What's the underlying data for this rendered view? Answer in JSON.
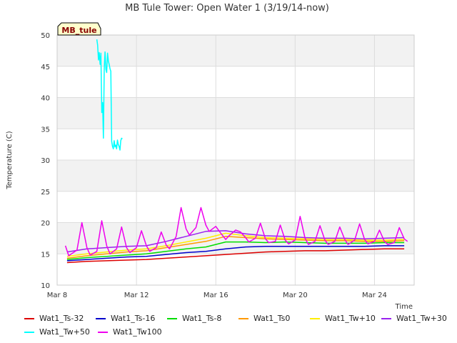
{
  "chart_data": {
    "type": "line",
    "title": "MB Tule Tower: Open Water 1 (3/19/14-now)",
    "xlabel": "Time",
    "ylabel": "Temperature (C)",
    "xlim": [
      "2014-03-08",
      "2014-03-26"
    ],
    "ylim": [
      10,
      50
    ],
    "x_ticks": [
      {
        "date": "2014-03-08",
        "label": "Mar 8"
      },
      {
        "date": "2014-03-12",
        "label": "Mar 12"
      },
      {
        "date": "2014-03-16",
        "label": "Mar 16"
      },
      {
        "date": "2014-03-20",
        "label": "Mar 20"
      },
      {
        "date": "2014-03-24",
        "label": "Mar 24"
      }
    ],
    "y_ticks": [
      10,
      15,
      20,
      25,
      30,
      35,
      40,
      45,
      50
    ],
    "grid": true,
    "banding": "alternating gray bands between y ticks",
    "annotation": "MB_tule",
    "legend_position": "bottom",
    "series": [
      {
        "name": "Wat1_Ts-32",
        "color": "#dd0000",
        "x": [
          "2014-03-08T12:00",
          "2014-03-09T12:00",
          "2014-03-10T12:00",
          "2014-03-11T12:00",
          "2014-03-12T12:00",
          "2014-03-13T12:00",
          "2014-03-14T12:00",
          "2014-03-15T12:00",
          "2014-03-16T12:00",
          "2014-03-17T12:00",
          "2014-03-18T12:00",
          "2014-03-19T12:00",
          "2014-03-20T12:00",
          "2014-03-21T12:00",
          "2014-03-22T12:00",
          "2014-03-23T12:00",
          "2014-03-24T12:00",
          "2014-03-25T12:00"
        ],
        "y": [
          13.6,
          13.8,
          13.9,
          14.0,
          14.1,
          14.3,
          14.5,
          14.7,
          14.9,
          15.1,
          15.3,
          15.4,
          15.5,
          15.5,
          15.6,
          15.7,
          15.8,
          15.8
        ]
      },
      {
        "name": "Wat1_Ts-16",
        "color": "#0000cc",
        "x": [
          "2014-03-08T12:00",
          "2014-03-09T12:00",
          "2014-03-10T12:00",
          "2014-03-11T12:00",
          "2014-03-12T12:00",
          "2014-03-13T12:00",
          "2014-03-14T12:00",
          "2014-03-15T12:00",
          "2014-03-16T12:00",
          "2014-03-17T12:00",
          "2014-03-18T12:00",
          "2014-03-19T12:00",
          "2014-03-20T12:00",
          "2014-03-21T12:00",
          "2014-03-22T12:00",
          "2014-03-23T12:00",
          "2014-03-24T12:00",
          "2014-03-25T12:00"
        ],
        "y": [
          13.9,
          14.1,
          14.3,
          14.5,
          14.6,
          14.9,
          15.2,
          15.4,
          15.8,
          16.1,
          16.2,
          16.2,
          16.2,
          16.2,
          16.2,
          16.2,
          16.3,
          16.3
        ]
      },
      {
        "name": "Wat1_Ts-8",
        "color": "#00dd00",
        "x": [
          "2014-03-08T12:00",
          "2014-03-09T12:00",
          "2014-03-10T12:00",
          "2014-03-11T12:00",
          "2014-03-12T12:00",
          "2014-03-13T12:00",
          "2014-03-14T12:00",
          "2014-03-15T12:00",
          "2014-03-16T12:00",
          "2014-03-17T12:00",
          "2014-03-18T12:00",
          "2014-03-19T12:00",
          "2014-03-20T12:00",
          "2014-03-21T12:00",
          "2014-03-22T12:00",
          "2014-03-23T12:00",
          "2014-03-24T12:00",
          "2014-03-25T12:00"
        ],
        "y": [
          14.1,
          14.4,
          14.6,
          14.8,
          15.0,
          15.4,
          15.8,
          16.1,
          16.9,
          16.9,
          16.8,
          16.9,
          16.8,
          16.7,
          16.7,
          16.7,
          16.8,
          16.8
        ]
      },
      {
        "name": "Wat1_Ts0",
        "color": "#ff9900",
        "x": [
          "2014-03-08T12:00",
          "2014-03-09T12:00",
          "2014-03-10T12:00",
          "2014-03-11T12:00",
          "2014-03-12T12:00",
          "2014-03-13T12:00",
          "2014-03-14T12:00",
          "2014-03-15T12:00",
          "2014-03-16T12:00",
          "2014-03-17T12:00",
          "2014-03-18T12:00",
          "2014-03-19T12:00",
          "2014-03-20T12:00",
          "2014-03-21T12:00",
          "2014-03-22T12:00",
          "2014-03-23T12:00",
          "2014-03-24T12:00",
          "2014-03-25T12:00"
        ],
        "y": [
          14.3,
          14.7,
          15.0,
          15.3,
          15.5,
          16.0,
          16.5,
          17.0,
          17.8,
          17.6,
          17.4,
          17.3,
          17.2,
          17.1,
          17.1,
          17.0,
          17.0,
          17.1
        ]
      },
      {
        "name": "Wat1_Tw+10",
        "color": "#ffee00",
        "x": [
          "2014-03-08T12:00",
          "2014-03-09T12:00",
          "2014-03-10T12:00",
          "2014-03-11T12:00",
          "2014-03-12T12:00",
          "2014-03-13T12:00",
          "2014-03-14T12:00",
          "2014-03-15T12:00",
          "2014-03-16T12:00",
          "2014-03-17T12:00",
          "2014-03-18T12:00",
          "2014-03-19T12:00",
          "2014-03-20T12:00",
          "2014-03-21T12:00",
          "2014-03-22T12:00",
          "2014-03-23T12:00",
          "2014-03-24T12:00",
          "2014-03-25T12:00"
        ],
        "y": [
          14.6,
          15.0,
          15.3,
          15.6,
          15.8,
          16.3,
          16.9,
          17.5,
          18.3,
          17.9,
          17.6,
          17.5,
          17.4,
          17.3,
          17.3,
          17.2,
          17.2,
          17.3
        ]
      },
      {
        "name": "Wat1_Tw+30",
        "color": "#9922ee",
        "x": [
          "2014-03-08T12:00",
          "2014-03-09T12:00",
          "2014-03-10T12:00",
          "2014-03-11T12:00",
          "2014-03-12T12:00",
          "2014-03-13T12:00",
          "2014-03-14T12:00",
          "2014-03-15T12:00",
          "2014-03-16T12:00",
          "2014-03-17T12:00",
          "2014-03-18T12:00",
          "2014-03-19T12:00",
          "2014-03-20T12:00",
          "2014-03-21T12:00",
          "2014-03-22T12:00",
          "2014-03-23T12:00",
          "2014-03-24T12:00",
          "2014-03-25T12:00"
        ],
        "y": [
          15.3,
          15.8,
          16.0,
          16.2,
          16.3,
          17.0,
          17.8,
          18.6,
          18.7,
          18.2,
          17.9,
          17.8,
          17.6,
          17.5,
          17.5,
          17.4,
          17.5,
          17.6
        ]
      },
      {
        "name": "Wat1_Tw+50",
        "color": "#00ffff",
        "x": [
          "2014-03-10T00:00",
          "2014-03-10T01:00",
          "2014-03-10T02:00",
          "2014-03-10T03:00",
          "2014-03-10T04:00",
          "2014-03-10T05:00",
          "2014-03-10T06:00",
          "2014-03-10T07:00",
          "2014-03-10T08:00",
          "2014-03-10T09:00",
          "2014-03-10T10:00",
          "2014-03-10T11:00",
          "2014-03-10T12:00",
          "2014-03-10T13:00",
          "2014-03-10T14:00",
          "2014-03-10T15:00",
          "2014-03-10T16:00",
          "2014-03-10T17:00",
          "2014-03-10T18:00",
          "2014-03-10T19:00",
          "2014-03-10T20:00",
          "2014-03-10T21:00",
          "2014-03-10T22:00",
          "2014-03-10T23:00",
          "2014-03-11T00:00",
          "2014-03-11T01:00",
          "2014-03-11T02:00",
          "2014-03-11T03:00",
          "2014-03-11T04:00",
          "2014-03-11T05:00",
          "2014-03-11T06:00",
          "2014-03-11T07:00"
        ],
        "y": [
          49.3,
          48.4,
          46.0,
          47.2,
          45.3,
          47.1,
          37.6,
          39.2,
          33.5,
          44.7,
          47.3,
          44.5,
          44.0,
          47.1,
          45.8,
          45.3,
          44.6,
          44.2,
          33.0,
          32.2,
          31.8,
          33.1,
          32.1,
          32.4,
          31.8,
          33.2,
          32.5,
          32.2,
          31.6,
          33.1,
          33.5,
          33.4
        ]
      },
      {
        "name": "Wat1_Tw100",
        "color": "#ee00ee",
        "x": [
          "2014-03-08T10:00",
          "2014-03-08T14:00",
          "2014-03-09T00:00",
          "2014-03-09T06:00",
          "2014-03-09T12:00",
          "2014-03-09T16:00",
          "2014-03-10T00:00",
          "2014-03-10T06:00",
          "2014-03-10T12:00",
          "2014-03-10T16:00",
          "2014-03-11T00:00",
          "2014-03-11T06:00",
          "2014-03-11T12:00",
          "2014-03-11T16:00",
          "2014-03-12T00:00",
          "2014-03-12T06:00",
          "2014-03-12T12:00",
          "2014-03-12T16:00",
          "2014-03-13T00:00",
          "2014-03-13T06:00",
          "2014-03-13T12:00",
          "2014-03-13T16:00",
          "2014-03-14T00:00",
          "2014-03-14T06:00",
          "2014-03-14T12:00",
          "2014-03-14T16:00",
          "2014-03-15T00:00",
          "2014-03-15T06:00",
          "2014-03-15T12:00",
          "2014-03-15T16:00",
          "2014-03-16T00:00",
          "2014-03-16T06:00",
          "2014-03-16T12:00",
          "2014-03-16T16:00",
          "2014-03-17T00:00",
          "2014-03-17T06:00",
          "2014-03-17T12:00",
          "2014-03-17T16:00",
          "2014-03-18T00:00",
          "2014-03-18T06:00",
          "2014-03-18T12:00",
          "2014-03-18T16:00",
          "2014-03-19T00:00",
          "2014-03-19T06:00",
          "2014-03-19T12:00",
          "2014-03-19T16:00",
          "2014-03-20T00:00",
          "2014-03-20T06:00",
          "2014-03-20T12:00",
          "2014-03-20T16:00",
          "2014-03-21T00:00",
          "2014-03-21T06:00",
          "2014-03-21T12:00",
          "2014-03-21T16:00",
          "2014-03-22T00:00",
          "2014-03-22T06:00",
          "2014-03-22T12:00",
          "2014-03-22T16:00",
          "2014-03-23T00:00",
          "2014-03-23T06:00",
          "2014-03-23T12:00",
          "2014-03-23T16:00",
          "2014-03-24T00:00",
          "2014-03-24T06:00",
          "2014-03-24T12:00",
          "2014-03-24T16:00",
          "2014-03-25T00:00",
          "2014-03-25T06:00",
          "2014-03-25T12:00",
          "2014-03-25T16:00"
        ],
        "y": [
          16.3,
          14.7,
          15.6,
          20.0,
          16.0,
          14.8,
          15.4,
          20.3,
          16.3,
          15.0,
          15.8,
          19.3,
          16.0,
          15.2,
          16.0,
          18.7,
          16.3,
          15.4,
          16.0,
          18.5,
          16.4,
          15.8,
          17.8,
          22.4,
          19.0,
          18.0,
          19.2,
          22.4,
          19.6,
          18.6,
          19.4,
          18.3,
          17.3,
          17.9,
          18.8,
          18.5,
          17.6,
          16.9,
          17.5,
          19.9,
          17.4,
          16.8,
          17.0,
          19.6,
          17.2,
          16.6,
          17.2,
          21.0,
          17.5,
          16.5,
          17.0,
          19.5,
          17.2,
          16.5,
          17.0,
          19.3,
          17.3,
          16.5,
          17.2,
          19.8,
          17.3,
          16.6,
          17.0,
          18.8,
          17.0,
          16.5,
          16.8,
          19.2,
          17.4,
          17.0
        ]
      }
    ]
  }
}
